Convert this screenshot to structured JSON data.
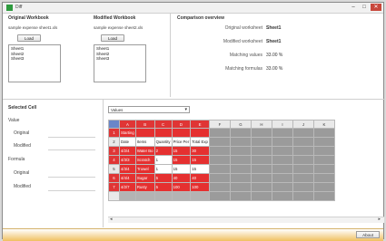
{
  "window": {
    "title": "Diff"
  },
  "original": {
    "title": "Original Workbook",
    "file": "sample expense sheet1.xls",
    "load_label": "Load",
    "sheets": [
      "Sheet1",
      "Sheet2",
      "Sheet3"
    ]
  },
  "modified": {
    "title": "Modified Workbook",
    "file": "sample expense sheet2.xls",
    "load_label": "Load",
    "sheets": [
      "Sheet1",
      "Sheet2",
      "Sheet3"
    ]
  },
  "comparison": {
    "title": "Comparison overview",
    "rows": [
      {
        "label": "Original worksheet",
        "value": "Sheet1"
      },
      {
        "label": "Modified worksheet",
        "value": "Sheet1"
      },
      {
        "label": "Matching values",
        "value": "33.00 %"
      },
      {
        "label": "Matching formulas",
        "value": "33.00 %"
      }
    ]
  },
  "selected_cell": {
    "title": "Selected Cell",
    "value_label": "Value",
    "original_label": "Original",
    "modified_label": "Modified",
    "formula_label": "Formula",
    "formula_original_label": "Original",
    "formula_modified_label": "Modified"
  },
  "view_select": {
    "value": "Values",
    "arrow": "▾"
  },
  "grid": {
    "columns": [
      "A",
      "B",
      "C",
      "D",
      "E",
      "F",
      "G",
      "H",
      "I",
      "J",
      "K"
    ],
    "rows": [
      {
        "num": "1",
        "cells": [
          "Starting",
          "",
          "",
          "",
          ""
        ]
      },
      {
        "num": "2",
        "cells": [
          "Date",
          "Items",
          "Quantity",
          "Price Per",
          "Total Exp"
        ]
      },
      {
        "num": "3",
        "cells": [
          "4/2/4",
          "Water Bo",
          "2",
          "15",
          "30"
        ]
      },
      {
        "num": "4",
        "cells": [
          "4/3/3",
          "Scratch",
          "1",
          "15",
          "15"
        ]
      },
      {
        "num": "5",
        "cells": [
          "4/3/4",
          "Trowel",
          "1",
          "15",
          "15"
        ]
      },
      {
        "num": "6",
        "cells": [
          "4/4/4",
          "Sugar",
          "5",
          "40",
          "40"
        ]
      },
      {
        "num": "7",
        "cells": [
          "4/2/7",
          "Rusty",
          "5",
          "100",
          "100"
        ]
      }
    ]
  },
  "scroll": {
    "left": "◂",
    "right": "▸"
  },
  "about_label": "About",
  "colors": {
    "diff": "#e53030",
    "selected_col": "#6a86c8",
    "status_bar": "#f0c060"
  }
}
